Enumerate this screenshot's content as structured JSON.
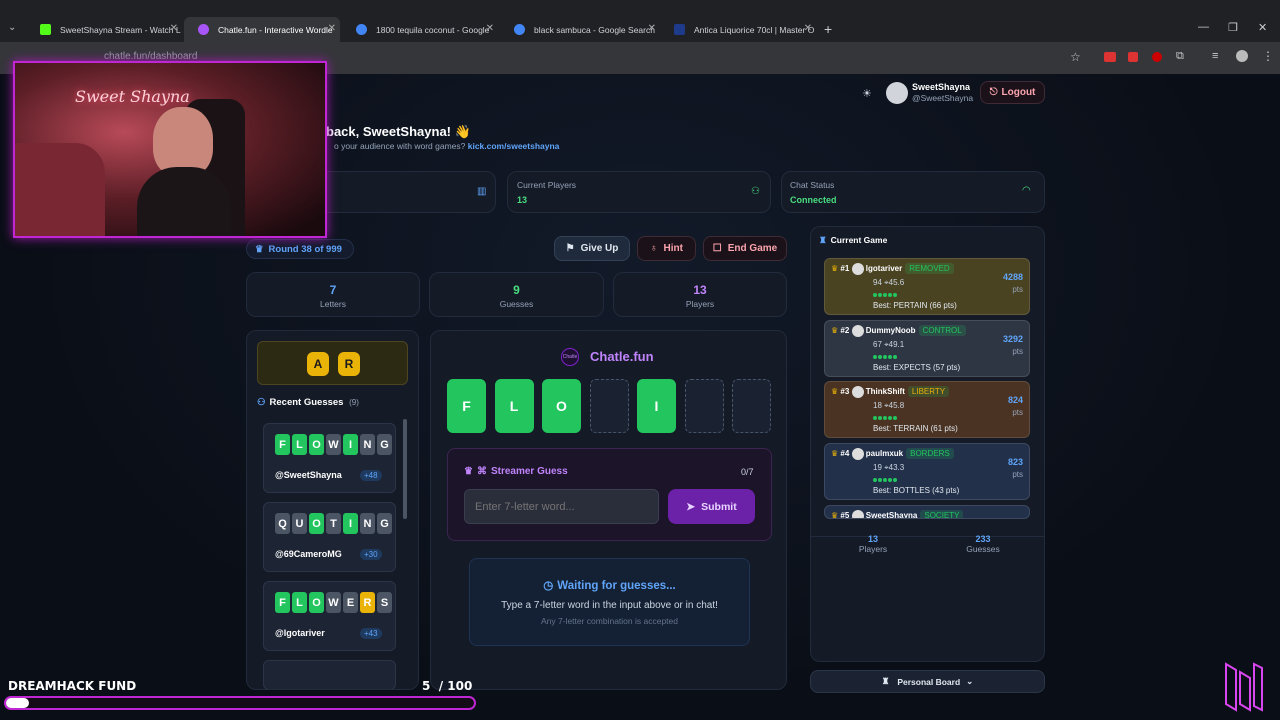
{
  "browser": {
    "tabs": [
      {
        "label": "SweetShayna Stream - Watch L",
        "color": "#53fc18"
      },
      {
        "label": "Chatle.fun - Interactive Wordle",
        "color": "#a855f7"
      },
      {
        "label": "1800 tequila coconut - Google",
        "color": "#4285f4"
      },
      {
        "label": "black sambuca - Google Search",
        "color": "#4285f4"
      },
      {
        "label": "Antica Liquorice 70cl | Master O",
        "color": "#1e3a8a"
      }
    ],
    "url": "chatle.fun/dashboard"
  },
  "header": {
    "username": "SweetShayna",
    "handle": "@SweetShayna",
    "logout_label": "Logout"
  },
  "welcome": {
    "title": "back, SweetShayna! 👋",
    "subtitle": "o your audience with word games?",
    "link": "kick.com/sweetshayna"
  },
  "stats": {
    "players_label": "Current Players",
    "players_value": "13",
    "chat_label": "Chat Status",
    "chat_value": "Connected"
  },
  "round": {
    "label": "Round 38 of 999"
  },
  "actions": {
    "give_up": "Give Up",
    "hint": "Hint",
    "end_game": "End Game"
  },
  "counters": [
    {
      "value": "7",
      "label": "Letters"
    },
    {
      "value": "9",
      "label": "Guesses"
    },
    {
      "value": "13",
      "label": "Players"
    }
  ],
  "hint_letters": [
    "A",
    "R"
  ],
  "recent": {
    "title": "Recent Guesses",
    "count": "(9)",
    "items": [
      {
        "letters": [
          "F",
          "L",
          "O",
          "W",
          "I",
          "N",
          "G"
        ],
        "states": [
          "g",
          "g",
          "g",
          "x",
          "g",
          "x",
          "x"
        ],
        "user": "@SweetShayna",
        "pts": "+48"
      },
      {
        "letters": [
          "Q",
          "U",
          "O",
          "T",
          "I",
          "N",
          "G"
        ],
        "states": [
          "x",
          "x",
          "g",
          "x",
          "g",
          "x",
          "x"
        ],
        "user": "@69CameroMG",
        "pts": "+30"
      },
      {
        "letters": [
          "F",
          "L",
          "O",
          "W",
          "E",
          "R",
          "S"
        ],
        "states": [
          "g",
          "g",
          "g",
          "x",
          "x",
          "y",
          "x"
        ],
        "user": "@lgotariver",
        "pts": "+43"
      }
    ]
  },
  "board": {
    "brand": "Chatle.fun",
    "letters": [
      "F",
      "L",
      "O",
      "",
      "I",
      "",
      ""
    ],
    "streamer_label": "Streamer Guess",
    "streamer_count": "0/7",
    "input_placeholder": "Enter 7-letter word...",
    "submit_label": "Submit",
    "waiting_title": "Waiting for guesses...",
    "waiting_text": "Type a 7-letter word in the input above or in chat!",
    "waiting_sub": "Any 7-letter combination is accepted"
  },
  "leaderboard": {
    "title": "Current Game",
    "rows": [
      {
        "rank": "#1",
        "name": "lgotariver",
        "tag": "REMOVED",
        "meta": "94 ⌖45.6",
        "best": "Best: PERTAIN (66 pts)",
        "pts": "4288",
        "unit": "pts",
        "bg": "#4a4322",
        "tagc": "#22c55e"
      },
      {
        "rank": "#2",
        "name": "DummyNoob",
        "tag": "CONTROL",
        "meta": "67 ⌖49.1",
        "best": "Best: EXPECTS (57 pts)",
        "pts": "3292",
        "unit": "pts",
        "bg": "#2e3644",
        "tagc": "#22c55e"
      },
      {
        "rank": "#3",
        "name": "ThinkShift",
        "tag": "LIBERTY",
        "meta": "18 ⌖45.8",
        "best": "Best: TERRAIN (61 pts)",
        "pts": "824",
        "unit": "pts",
        "bg": "#4a3322",
        "tagc": "#eab308"
      },
      {
        "rank": "#4",
        "name": "paulmxuk",
        "tag": "BORDERS",
        "meta": "19 ⌖43.3",
        "best": "Best: BOTTLES (43 pts)",
        "pts": "823",
        "unit": "pts",
        "bg": "#22304a",
        "tagc": "#22c55e"
      },
      {
        "rank": "#5",
        "name": "SweetShayna",
        "tag": "SOCIETY",
        "meta": "",
        "best": "",
        "pts": "",
        "unit": "",
        "bg": "#22304a",
        "tagc": "#22c55e"
      }
    ],
    "footer": [
      {
        "value": "13",
        "label": "Players"
      },
      {
        "value": "233",
        "label": "Guesses"
      }
    ],
    "personal_board": "Personal Board"
  },
  "overlay": {
    "fund_label": "DREAMHACK FUND",
    "fund_value": "5  / 100",
    "fund_progress": 0.05
  }
}
